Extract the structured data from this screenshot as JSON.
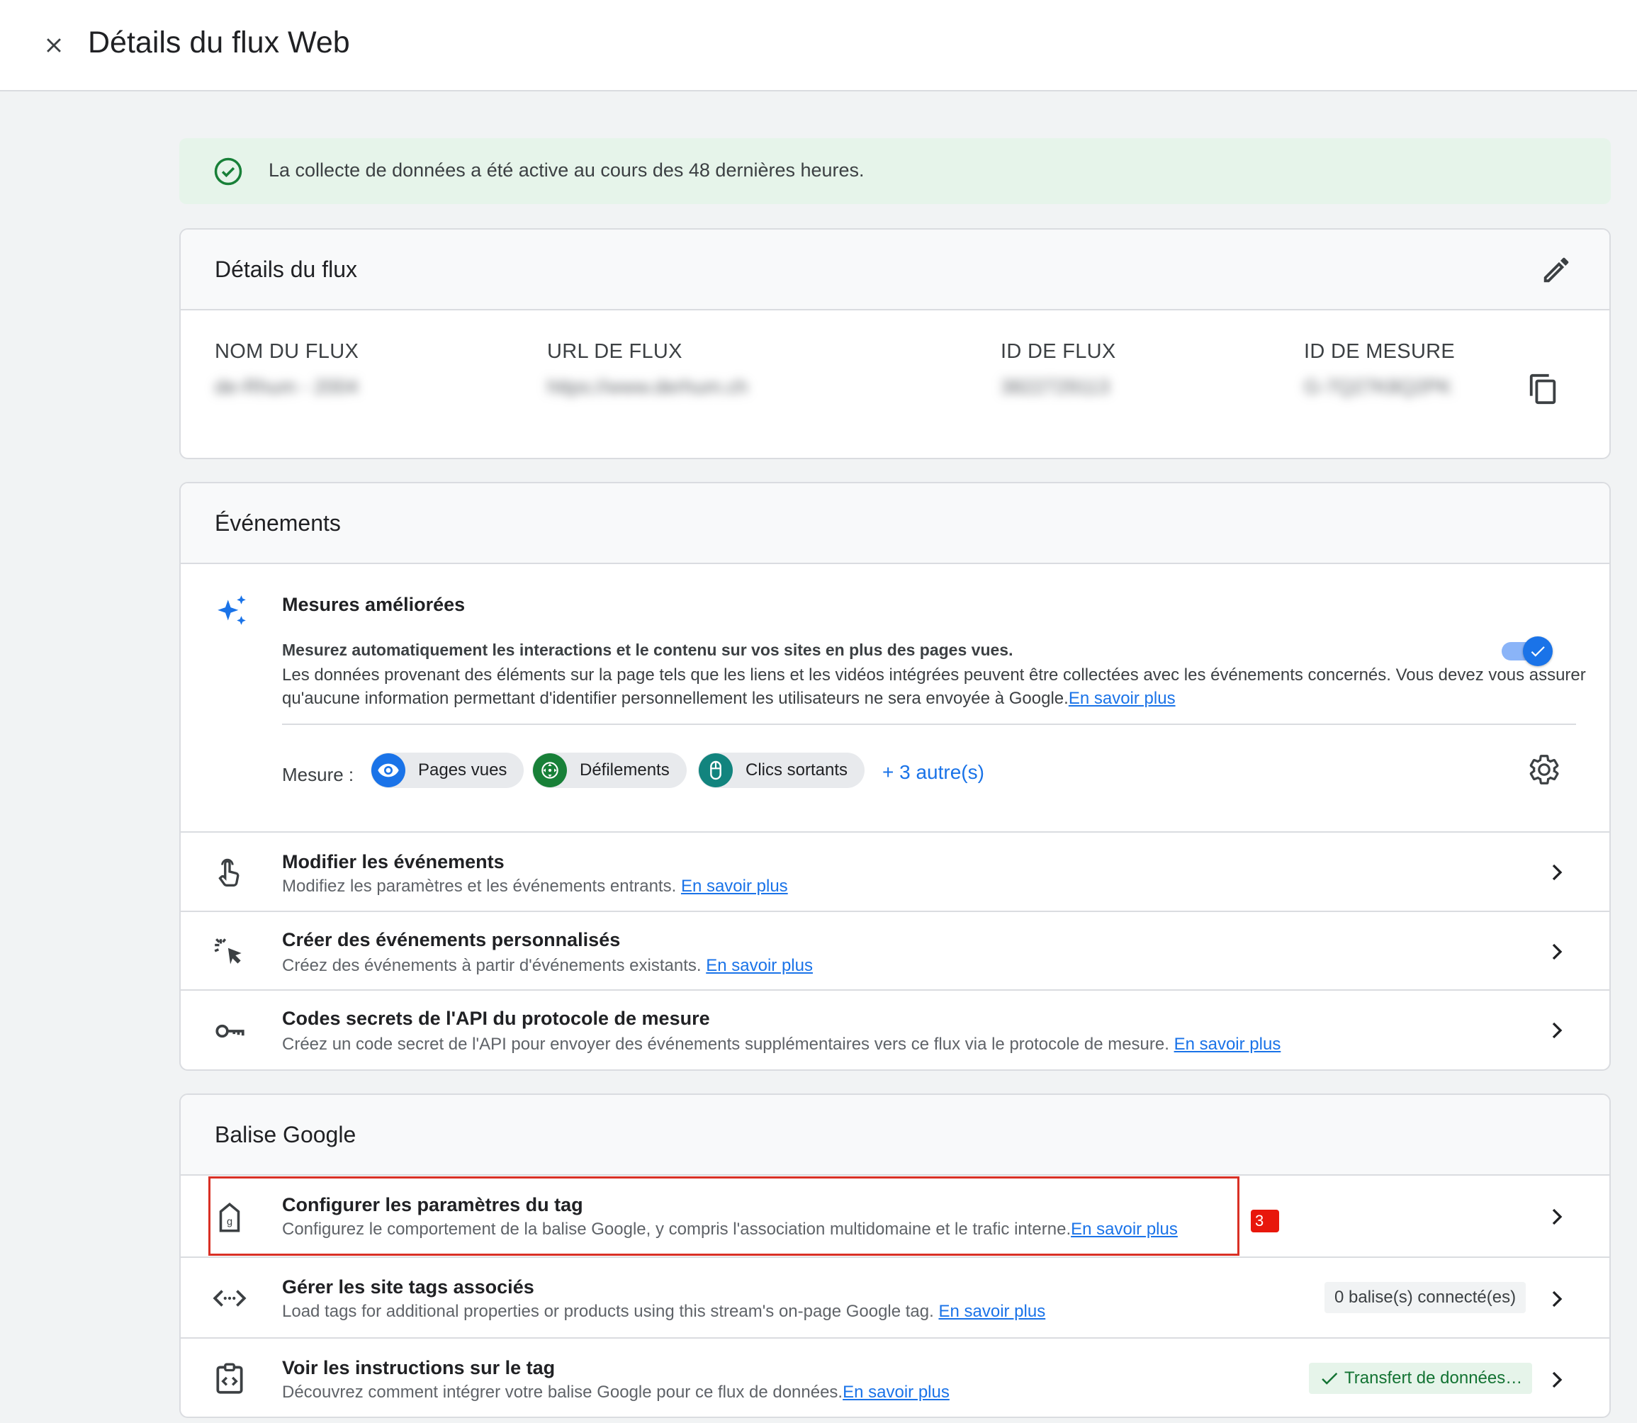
{
  "header": {
    "title": "Détails du flux Web"
  },
  "banner": {
    "text": "La collecte de données a été active au cours des 48 dernières heures."
  },
  "stream_details": {
    "title": "Détails du flux",
    "columns": [
      {
        "label": "NOM DU FLUX",
        "value": "de-Rhum - 2004"
      },
      {
        "label": "URL DE FLUX",
        "value": "https://www.derhum.ch"
      },
      {
        "label": "ID DE FLUX",
        "value": "3822729113"
      },
      {
        "label": "ID DE MESURE",
        "value": "G-7Q27K8Q2PK"
      }
    ]
  },
  "events": {
    "title": "Événements",
    "enhanced": {
      "title": "Mesures améliorées",
      "desc_bold": "Mesurez automatiquement les interactions et le contenu sur vos sites en plus des pages vues.",
      "desc": "Les données provenant des éléments sur la page tels que les liens et les vidéos intégrées peuvent être collectées avec les événements concernés. Vous devez vous assurer qu'aucune information permettant d'identifier personnellement les utilisateurs ne sera envoyée à Google.",
      "link": "En savoir plus",
      "toggle_on": true,
      "measure_label": "Mesure :",
      "chips": [
        {
          "label": "Pages vues",
          "icon": "eye-icon",
          "color": "#1a73e8"
        },
        {
          "label": "Défilements",
          "icon": "scroll-arrows-icon",
          "color": "#188038"
        },
        {
          "label": "Clics sortants",
          "icon": "mouse-icon",
          "color": "#12847e"
        }
      ],
      "more": "+ 3 autre(s)"
    },
    "rows": [
      {
        "title": "Modifier les événements",
        "desc": "Modifiez les paramètres et les événements entrants.",
        "link": "En savoir plus"
      },
      {
        "title": "Créer des événements personnalisés",
        "desc": "Créez des événements à partir d'événements existants.",
        "link": "En savoir plus"
      },
      {
        "title": "Codes secrets de l'API du protocole de mesure",
        "desc": "Créez un code secret de l'API pour envoyer des événements supplémentaires vers ce flux via le protocole de mesure.",
        "link": "En savoir plus"
      }
    ]
  },
  "google_tag": {
    "title": "Balise Google",
    "badge": "3",
    "rows": [
      {
        "title": "Configurer les paramètres du tag",
        "desc": "Configurez le comportement de la balise Google, y compris l'association multidomaine et le trafic interne.",
        "link": "En savoir plus"
      },
      {
        "title": "Gérer les site tags associés",
        "desc": "Load tags for additional properties or products using this stream's on-page Google tag.",
        "link": "En savoir plus",
        "status": "0 balise(s) connecté(es)"
      },
      {
        "title": "Voir les instructions sur le tag",
        "desc": "Découvrez comment intégrer votre balise Google pour ce flux de données.",
        "link": "En savoir plus",
        "status": "Transfert de données…"
      }
    ]
  },
  "colors": {
    "accent": "#1a73e8",
    "success": "#188038",
    "highlight": "#d93025"
  }
}
